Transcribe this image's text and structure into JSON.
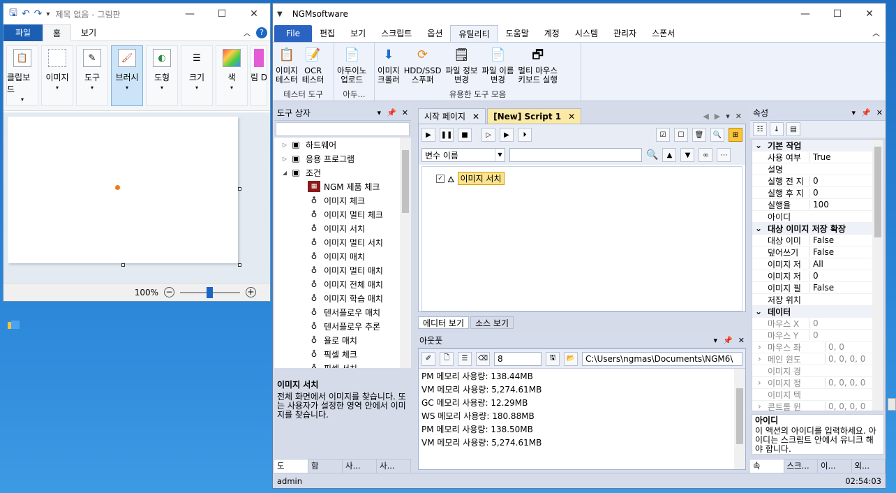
{
  "paint": {
    "title": "제목 없음 - 그림판",
    "tabs": [
      "파일",
      "홈",
      "보기"
    ],
    "tools": [
      {
        "label": "클립보드",
        "icon": "clipboard-icon"
      },
      {
        "label": "이미지",
        "icon": "image-select-icon"
      },
      {
        "label": "도구",
        "icon": "tools-icon"
      },
      {
        "label": "브러시",
        "icon": "brush-icon"
      },
      {
        "label": "도형",
        "icon": "shapes-icon"
      },
      {
        "label": "크기",
        "icon": "size-icon"
      },
      {
        "label": "색",
        "icon": "color-icon"
      },
      {
        "label": "그림 D로",
        "icon": "paint3d-icon"
      }
    ],
    "zoom": "100%",
    "zoom_level": 0.5
  },
  "ngm": {
    "title": "NGMsoftware",
    "menus": [
      "File",
      "편집",
      "보기",
      "스크립트",
      "옵션",
      "유틸리티",
      "도움말",
      "계정",
      "시스템",
      "관리자",
      "스폰서"
    ],
    "ribbon_groups": [
      {
        "name": "테스터 도구",
        "buttons": [
          {
            "label": "이미지\n테스터",
            "icon": "image-tester-icon"
          },
          {
            "label": "OCR\n테스터",
            "icon": "ocr-tester-icon"
          }
        ]
      },
      {
        "name": "아두...",
        "buttons": [
          {
            "label": "아두이노\n업로드",
            "icon": "arduino-upload-icon"
          }
        ]
      },
      {
        "name": "유용한 도구 모음",
        "buttons": [
          {
            "label": "이미지\n크롤러",
            "icon": "download-icon"
          },
          {
            "label": "HDD/SSD\n스푸퍼",
            "icon": "spoofer-icon"
          },
          {
            "label": "파일 정보\n변경",
            "icon": "file-info-icon"
          },
          {
            "label": "파일 이름\n변경",
            "icon": "rename-icon"
          },
          {
            "label": "멀티 마우스\n키보드 실행",
            "icon": "multi-window-icon"
          }
        ]
      }
    ],
    "toolbox": {
      "title": "도구 상자",
      "tree": [
        {
          "label": "하드웨어",
          "level": 0,
          "exp": "▷",
          "icon": "computer-icon"
        },
        {
          "label": "응용 프로그램",
          "level": 0,
          "exp": "▷",
          "icon": "console-icon"
        },
        {
          "label": "조건",
          "level": 0,
          "exp": "◢",
          "icon": "condition-icon"
        },
        {
          "label": "NGM 제품 체크",
          "level": 1,
          "icon": "ngm-product-icon"
        },
        {
          "label": "이미지 체크",
          "level": 1,
          "icon": "image-check-icon"
        },
        {
          "label": "이미지 멀티 체크",
          "level": 1,
          "icon": "image-multi-check-icon"
        },
        {
          "label": "이미지 서치",
          "level": 1,
          "icon": "image-search-icon"
        },
        {
          "label": "이미지 멀티 서치",
          "level": 1,
          "icon": "image-multi-search-icon"
        },
        {
          "label": "이미지 매치",
          "level": 1,
          "icon": "image-match-icon"
        },
        {
          "label": "이미지 멀티 매치",
          "level": 1,
          "icon": "image-multi-match-icon"
        },
        {
          "label": "이미지 전체 매치",
          "level": 1,
          "icon": "image-all-match-icon"
        },
        {
          "label": "이미지 학습 매치",
          "level": 1,
          "icon": "image-learn-match-icon"
        },
        {
          "label": "텐서플로우 매치",
          "level": 1,
          "icon": "tensorflow-match-icon"
        },
        {
          "label": "텐서플로우 추론",
          "level": 1,
          "icon": "tensorflow-infer-icon"
        },
        {
          "label": "욜로 매치",
          "level": 1,
          "icon": "yolo-match-icon"
        },
        {
          "label": "픽셀 체크",
          "level": 1,
          "icon": "pixel-check-icon"
        },
        {
          "label": "픽셀 서치",
          "level": 1,
          "icon": "pixel-search-icon"
        }
      ],
      "desc_title": "이미지 서치",
      "desc_text": "전체 화면에서 이미지를 찾습니다. 또는 사용자가 설정한 영역 안에서 이미지를 찾습니다.",
      "bottom_tabs": [
        "도",
        "함",
        "사...",
        "사..."
      ]
    },
    "editor": {
      "tabs": [
        "시작 페이지",
        "[New] Script 1"
      ],
      "combo": "변수 이름",
      "script_item": "이미지 서치",
      "bottom_tabs": [
        "에디터 보기",
        "소스 보기"
      ]
    },
    "output": {
      "title": "아웃풋",
      "spin_value": "8",
      "path": "C:\\Users\\ngmas\\Documents\\NGM6\\",
      "logs": [
        "PM 메모리 사용량: 138.44MB",
        "VM 메모리 사용량: 5,274.61MB",
        "GC 메모리 사용량: 12.29MB",
        "WS 메모리 사용량: 180.88MB",
        "PM 메모리 사용량: 138.50MB",
        "VM 메모리 사용량: 5,274.61MB"
      ]
    },
    "properties": {
      "title": "속성",
      "rows": [
        {
          "k": "기본 작업",
          "v": "",
          "cat": true
        },
        {
          "k": "사용 여부",
          "v": "True"
        },
        {
          "k": "설명",
          "v": ""
        },
        {
          "k": "실행 전 지",
          "v": "0"
        },
        {
          "k": "실행 후 지",
          "v": "0"
        },
        {
          "k": "실행율",
          "v": "100"
        },
        {
          "k": "아이디",
          "v": ""
        },
        {
          "k": "대상 이미지 저장 확장",
          "v": "",
          "cat": true
        },
        {
          "k": "대상 이미",
          "v": "False"
        },
        {
          "k": "덮어쓰기",
          "v": "False"
        },
        {
          "k": "이미지 저",
          "v": "All"
        },
        {
          "k": "이미지 저",
          "v": "0"
        },
        {
          "k": "이미지 필",
          "v": "False"
        },
        {
          "k": "저장 위치",
          "v": ""
        },
        {
          "k": "데이터",
          "v": "",
          "cat": true
        },
        {
          "k": "마우스 X",
          "v": "0",
          "dis": true
        },
        {
          "k": "마우스 Y",
          "v": "0",
          "dis": true
        },
        {
          "k": "마우스 좌",
          "v": "0, 0",
          "dis": true,
          "exp": true
        },
        {
          "k": "메인 윈도",
          "v": "0, 0, 0, 0",
          "dis": true,
          "exp": true
        },
        {
          "k": "이미지 경",
          "v": "",
          "dis": true
        },
        {
          "k": "이미지 정",
          "v": "0, 0, 0, 0",
          "dis": true,
          "exp": true
        },
        {
          "k": "이미지 텍",
          "v": "",
          "dis": true
        },
        {
          "k": "콘트롤 윈",
          "v": "0, 0, 0, 0",
          "dis": true,
          "exp": true
        }
      ],
      "desc_title": "아이디",
      "desc_text": "이 액션의 아이디를 입력하세요. 아이디는 스크립트 안에서 유니크 해야 합니다.",
      "bottom_tabs": [
        "속",
        "스크...",
        "이...",
        "외..."
      ]
    },
    "status": {
      "user": "admin",
      "time": "02:54:03"
    }
  }
}
